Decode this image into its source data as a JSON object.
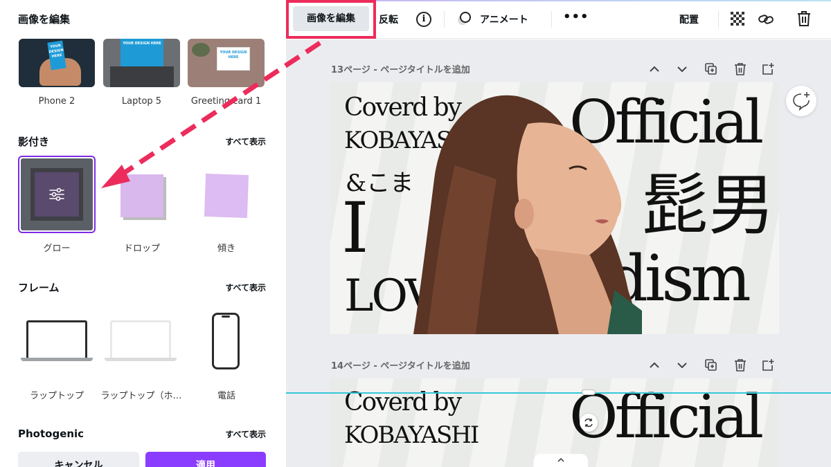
{
  "panel": {
    "title": "画像を編集",
    "mockups": [
      {
        "label": "Phone 2",
        "screen_text": "YOUR DESIGN HERE"
      },
      {
        "label": "Laptop 5",
        "screen_text": "YOUR DESIGN HERE"
      },
      {
        "label": "Greeting card 1",
        "screen_text": "YOUR DESIGN HERE"
      }
    ],
    "shadows": {
      "title": "影付き",
      "see_all": "すべて表示",
      "items": [
        {
          "label": "グロー",
          "selected": true
        },
        {
          "label": "ドロップ"
        },
        {
          "label": "傾き"
        }
      ]
    },
    "frames": {
      "title": "フレーム",
      "see_all": "すべて表示",
      "items": [
        {
          "label": "ラップトップ"
        },
        {
          "label": "ラップトップ（ホ…"
        },
        {
          "label": "電話"
        }
      ]
    },
    "photogenic": {
      "title": "Photogenic",
      "see_all": "すべて表示"
    },
    "cancel": "キャンセル",
    "apply": "適用"
  },
  "toolbar": {
    "edit_image": "画像を編集",
    "flip": "反転",
    "info_glyph": "i",
    "animate": "アニメート",
    "more": "•••",
    "arrange": "配置",
    "icons": [
      "transparency-icon",
      "link-icon",
      "trash-icon"
    ]
  },
  "pages": [
    {
      "label": "13ページ - ページタイトルを追加",
      "lines_left": [
        "Coverd by",
        "KOBAYAS",
        "&こま",
        "I",
        "LOV"
      ],
      "lines_right": [
        "Official",
        "髭男",
        "dism"
      ]
    },
    {
      "label": "14ページ - ページタイトルを追加",
      "lines_left": [
        "Coverd by",
        "KOBAYASHI"
      ],
      "lines_right": [
        "Official"
      ]
    }
  ],
  "colors": {
    "accent": "#8b3dff",
    "highlight": "#ec2c5b",
    "guide": "#35c6d9"
  }
}
